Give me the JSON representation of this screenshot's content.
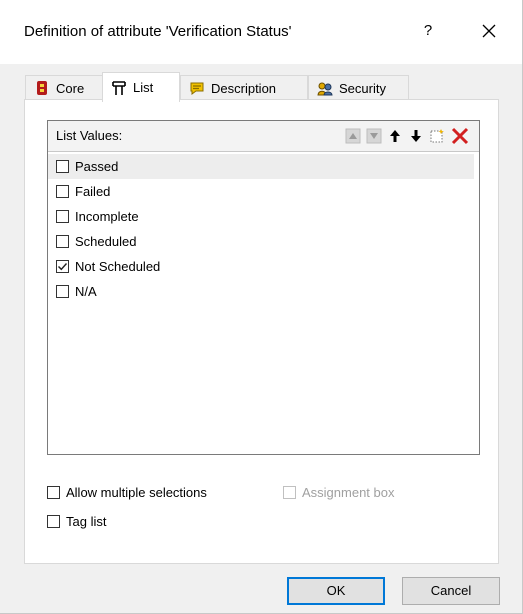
{
  "window": {
    "title": "Definition of attribute 'Verification Status'",
    "help_label": "?"
  },
  "tabs": [
    {
      "label": "Core",
      "icon": "core-icon",
      "active": false
    },
    {
      "label": "List",
      "icon": "list-icon",
      "active": true
    },
    {
      "label": "Description",
      "icon": "description-icon",
      "active": false
    },
    {
      "label": "Security",
      "icon": "security-icon",
      "active": false
    }
  ],
  "list_panel": {
    "header": "List Values:",
    "toolbar": [
      "move-up-disabled-icon",
      "move-down-disabled-icon",
      "arrow-up-icon",
      "arrow-down-icon",
      "new-item-icon",
      "delete-icon"
    ],
    "items": [
      {
        "label": "Passed",
        "checked": false,
        "selected": true
      },
      {
        "label": "Failed",
        "checked": false,
        "selected": false
      },
      {
        "label": "Incomplete",
        "checked": false,
        "selected": false
      },
      {
        "label": "Scheduled",
        "checked": false,
        "selected": false
      },
      {
        "label": "Not Scheduled",
        "checked": true,
        "selected": false
      },
      {
        "label": "N/A",
        "checked": false,
        "selected": false
      }
    ]
  },
  "options": {
    "allow_multiple": {
      "label": "Allow multiple selections",
      "checked": false
    },
    "assignment_box": {
      "label": "Assignment box",
      "checked": false,
      "enabled": false
    },
    "tag_list": {
      "label": "Tag list",
      "checked": false
    }
  },
  "buttons": {
    "ok": "OK",
    "cancel": "Cancel"
  },
  "colors": {
    "accent": "#0078d7",
    "delete": "#d21f1f",
    "description_icon": "#f2c200"
  }
}
